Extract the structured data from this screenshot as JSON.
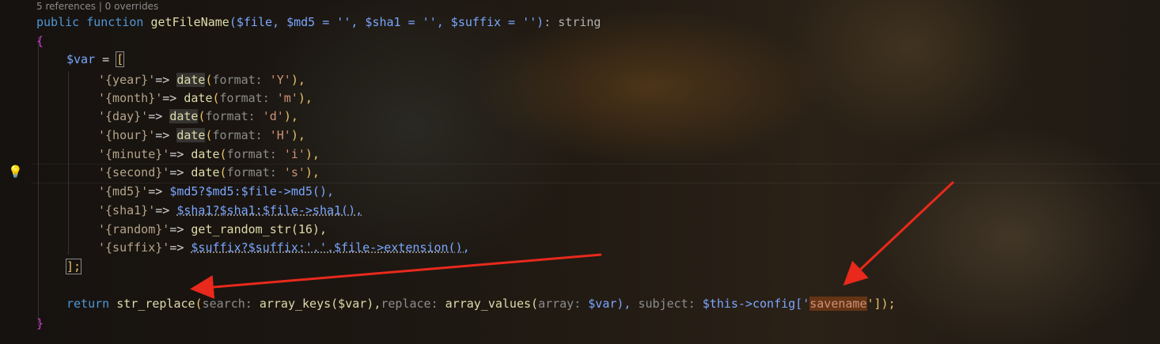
{
  "editor": {
    "codelens": "5 references | 0 overrides",
    "signature": {
      "keyword_public": "public",
      "keyword_function": "function",
      "name": "getFileName",
      "params": "($file, $md5 = '', $sha1 = '', $suffix = '')",
      "return_sep": ":",
      "return_type": "string"
    },
    "open_brace": "{",
    "var_decl": {
      "name": "$var",
      "assign": " = ",
      "open_bracket": "["
    },
    "entries": [
      {
        "key": "'{year}'",
        "arrow": "=> ",
        "value_fn": "date",
        "hint": "format:",
        "arg": "'Y'",
        "tail": "),"
      },
      {
        "key": "'{month}'",
        "arrow": "=> ",
        "value_fn": "date",
        "hint": "format:",
        "arg": "'m'",
        "tail": "),"
      },
      {
        "key": "'{day}'",
        "arrow": "=> ",
        "value_fn": "date",
        "hint": "format:",
        "arg": "'d'",
        "tail": "),"
      },
      {
        "key": "'{hour}'",
        "arrow": "=> ",
        "value_fn": "date",
        "hint": "format:",
        "arg": "'H'",
        "tail": "),"
      },
      {
        "key": "'{minute}'",
        "arrow": "=> ",
        "value_fn": "date",
        "hint": "format:",
        "arg": "'i'",
        "tail": "),"
      },
      {
        "key": "'{second}'",
        "arrow": "=> ",
        "value_fn": "date",
        "hint": "format:",
        "arg": "'s'",
        "tail": "),"
      }
    ],
    "md5_line": {
      "key": "'{md5}'",
      "arrow": "=> ",
      "code": "$md5?$md5:$file->md5(),"
    },
    "sha1_line": {
      "key": "'{sha1}'",
      "arrow": "=> ",
      "code": "$sha1?$sha1:$file->sha1(),"
    },
    "random_line": {
      "key": "'{random}'",
      "arrow": "=> ",
      "code": "get_random_str(16),"
    },
    "suffix_line": {
      "key": "'{suffix}'",
      "arrow": "=> ",
      "code": "$suffix?$suffix:'.'.$file->extension(),"
    },
    "close_bracket": "];",
    "return_line": {
      "keyword": "return",
      "fn": "str_replace",
      "hint_search": "search:",
      "arg1": "array_keys($var),",
      "hint_replace": "replace:",
      "arg2_fn": "array_values(",
      "hint_array": "array:",
      "arg2_rest": "$var),",
      "hint_subject": "subject:",
      "arg3_pre": "$this->config['",
      "arg3_key": "savename",
      "arg3_post": "']);"
    },
    "close_brace": "}"
  },
  "gutter": {
    "lightbulb_icon": "lightbulb-icon"
  },
  "annotations": {
    "arrow_color": "#e8291c"
  }
}
